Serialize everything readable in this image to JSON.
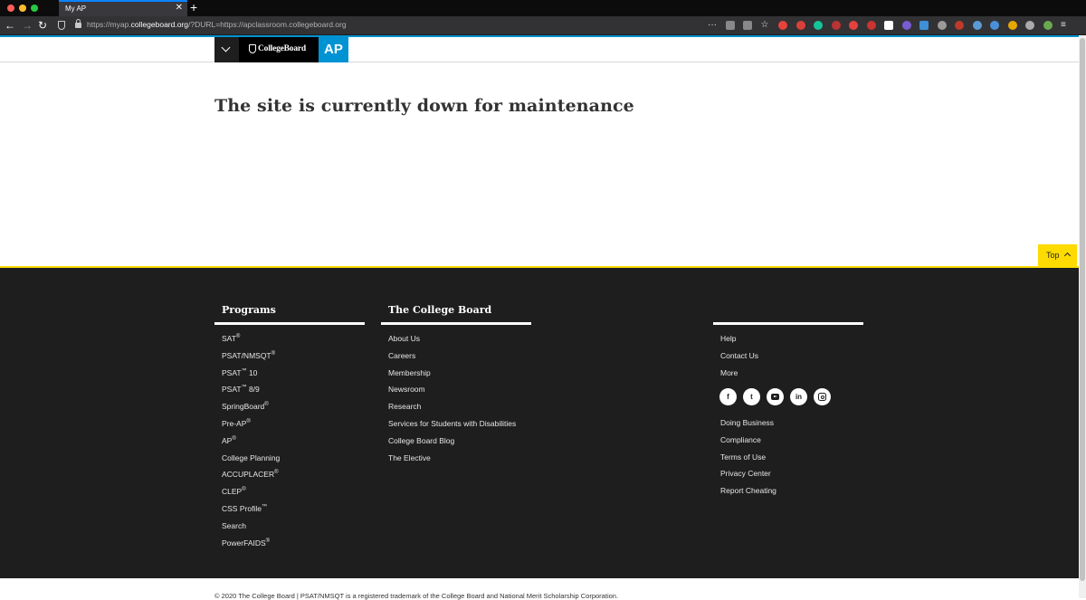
{
  "browser": {
    "tab_title": "My AP",
    "tab_close": "✕",
    "new_tab": "+",
    "url_prefix": "https://myap.",
    "url_host": "collegeboard.org",
    "url_rest": "/?DURL=https://apclassroom.collegeboard.org",
    "nav_back": "←",
    "nav_forward": "→",
    "nav_reload": "↻",
    "extensions": [
      "more-dots-icon",
      "pocket-icon",
      "download-icon",
      "bookmark-star-icon",
      "ublock-icon",
      "extension-icon",
      "grammarly-icon",
      "extension-icon",
      "extension-icon",
      "extension-icon",
      "play-icon",
      "extension-icon",
      "grid-icon",
      "extension-icon",
      "extension-icon",
      "extension-icon",
      "extension-icon",
      "extension-icon",
      "extension-icon",
      "extension-icon",
      "menu-icon"
    ],
    "extension_glyphs": {
      "dots": "···",
      "star": "☆",
      "menu": "≡"
    }
  },
  "header": {
    "menu_toggle_icon": "chevron-down-icon",
    "brand_name": "CollegeBoard",
    "program_logo": "AP"
  },
  "main": {
    "message": "The site is currently down for maintenance"
  },
  "back_to_top": {
    "label": "Top"
  },
  "footer": {
    "programs": {
      "heading": "Programs",
      "items": [
        {
          "label": "SAT",
          "mark": "®"
        },
        {
          "label": "PSAT/NMSQT",
          "mark": "®"
        },
        {
          "label": "PSAT",
          "mark": "™",
          "suffix": " 10"
        },
        {
          "label": "PSAT",
          "mark": "™",
          "suffix": " 8/9"
        },
        {
          "label": "SpringBoard",
          "mark": "®"
        },
        {
          "label": "Pre-AP",
          "mark": "®"
        },
        {
          "label": "AP",
          "mark": "®"
        },
        {
          "label": "College Planning",
          "mark": ""
        },
        {
          "label": "ACCUPLACER",
          "mark": "®"
        },
        {
          "label": "CLEP",
          "mark": "®"
        },
        {
          "label": "CSS Profile",
          "mark": "™"
        },
        {
          "label": "Search",
          "mark": ""
        },
        {
          "label": "PowerFAIDS",
          "mark": "®"
        }
      ]
    },
    "college_board": {
      "heading": "The College Board",
      "items": [
        "About Us",
        "Careers",
        "Membership",
        "Newsroom",
        "Research",
        "Services for Students with Disabilities",
        "College Board Blog",
        "The Elective"
      ]
    },
    "help": {
      "items": [
        "Help",
        "Contact Us",
        "More"
      ],
      "social": [
        {
          "name": "facebook-icon",
          "glyph": "f"
        },
        {
          "name": "twitter-icon",
          "glyph": "t"
        },
        {
          "name": "youtube-icon",
          "glyph": ""
        },
        {
          "name": "linkedin-icon",
          "glyph": "in"
        },
        {
          "name": "instagram-icon",
          "glyph": ""
        }
      ],
      "secondary_items": [
        "Doing Business",
        "Compliance",
        "Terms of Use",
        "Privacy Center",
        "Report Cheating"
      ]
    },
    "legal": "© 2020 The College Board | PSAT/NMSQT is a registered trademark of the College Board and National Merit Scholarship Corporation."
  },
  "colors": {
    "accent_blue": "#0093d4",
    "accent_yellow": "#fedb00",
    "footer_bg": "#1e1e1e",
    "browser_chrome": "#323234"
  }
}
